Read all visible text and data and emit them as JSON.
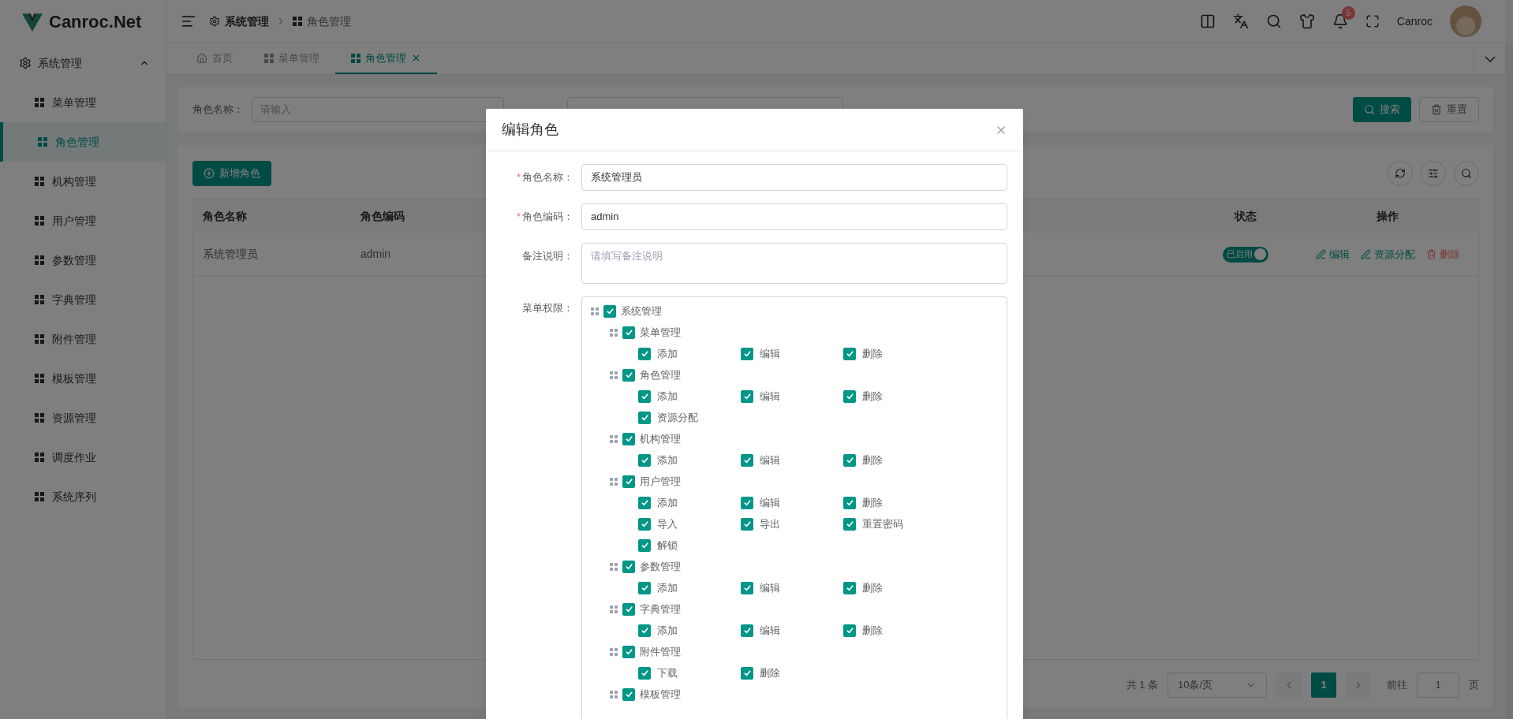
{
  "app": {
    "logo_text": "Canroc.Net"
  },
  "header": {
    "breadcrumb": [
      {
        "label": "系统管理"
      },
      {
        "label": "角色管理"
      }
    ],
    "notification_count": "5",
    "user_name": "Canroc"
  },
  "tabs": [
    {
      "label": "首页",
      "selected": false
    },
    {
      "label": "菜单管理",
      "selected": false
    },
    {
      "label": "角色管理",
      "selected": true
    }
  ],
  "sidebar": {
    "items": [
      {
        "label": "系统管理",
        "expanded": true,
        "children": [
          {
            "label": "菜单管理",
            "selected": false
          },
          {
            "label": "角色管理",
            "selected": true
          },
          {
            "label": "机构管理",
            "selected": false
          },
          {
            "label": "用户管理",
            "selected": false
          },
          {
            "label": "参数管理",
            "selected": false
          },
          {
            "label": "字典管理",
            "selected": false
          },
          {
            "label": "附件管理",
            "selected": false
          },
          {
            "label": "模板管理",
            "selected": false
          },
          {
            "label": "资源管理",
            "selected": false
          },
          {
            "label": "调度作业",
            "selected": false
          },
          {
            "label": "系统序列",
            "selected": false
          }
        ]
      }
    ]
  },
  "search": {
    "label": "角色名称：",
    "placeholder": "请输入",
    "buttons": [
      {
        "label": "搜索",
        "kind": "primary"
      },
      {
        "label": "重置",
        "kind": "default"
      }
    ]
  },
  "table": {
    "add_button": "新增角色",
    "columns": [
      "角色名称",
      "角色编码",
      "状态",
      "操作"
    ],
    "rows": [
      {
        "cells": [
          "系统管理员",
          "admin"
        ],
        "status": {
          "label": "已启用",
          "on": true
        },
        "actions": [
          {
            "label": "编辑",
            "kind": "edit"
          },
          {
            "label": "资源分配",
            "kind": "edit"
          },
          {
            "label": "删除",
            "kind": "delete"
          }
        ]
      }
    ]
  },
  "pagination": {
    "total": "共 1 条",
    "page_size": "10条/页",
    "pages": [
      {
        "label": "1",
        "selected": true
      }
    ],
    "goto_label": "前往",
    "goto_value": "1",
    "goto_suffix": "页"
  },
  "dialog": {
    "title": "编辑角色",
    "fields": [
      {
        "label": "角色名称：",
        "required_mark": "*",
        "kind": "input",
        "value": "系统管理员"
      },
      {
        "label": "角色编码：",
        "required_mark": "*",
        "kind": "input",
        "value": "admin"
      },
      {
        "label": "备注说明：",
        "kind": "textarea",
        "placeholder": "请填写备注说明"
      }
    ],
    "tree_label": "菜单权限：",
    "tree": [
      {
        "label": "系统管理",
        "checked": true,
        "children": [
          {
            "label": "菜单管理",
            "checked": true,
            "actions": [
              {
                "label": "添加",
                "checked": true
              },
              {
                "label": "编辑",
                "checked": true
              },
              {
                "label": "删除",
                "checked": true
              }
            ]
          },
          {
            "label": "角色管理",
            "checked": true,
            "actions": [
              {
                "label": "添加",
                "checked": true
              },
              {
                "label": "编辑",
                "checked": true
              },
              {
                "label": "删除",
                "checked": true
              },
              {
                "label": "资源分配",
                "checked": true
              }
            ]
          },
          {
            "label": "机构管理",
            "checked": true,
            "actions": [
              {
                "label": "添加",
                "checked": true
              },
              {
                "label": "编辑",
                "checked": true
              },
              {
                "label": "删除",
                "checked": true
              }
            ]
          },
          {
            "label": "用户管理",
            "checked": true,
            "actions": [
              {
                "label": "添加",
                "checked": true
              },
              {
                "label": "编辑",
                "checked": true
              },
              {
                "label": "删除",
                "checked": true
              },
              {
                "label": "导入",
                "checked": true
              },
              {
                "label": "导出",
                "checked": true
              },
              {
                "label": "重置密码",
                "checked": true
              },
              {
                "label": "解锁",
                "checked": true
              }
            ]
          },
          {
            "label": "参数管理",
            "checked": true,
            "actions": [
              {
                "label": "添加",
                "checked": true
              },
              {
                "label": "编辑",
                "checked": true
              },
              {
                "label": "删除",
                "checked": true
              }
            ]
          },
          {
            "label": "字典管理",
            "checked": true,
            "actions": [
              {
                "label": "添加",
                "checked": true
              },
              {
                "label": "编辑",
                "checked": true
              },
              {
                "label": "删除",
                "checked": true
              }
            ]
          },
          {
            "label": "附件管理",
            "checked": true,
            "actions": [
              {
                "label": "下载",
                "checked": true
              },
              {
                "label": "删除",
                "checked": true
              }
            ]
          },
          {
            "label": "模板管理",
            "checked": true
          }
        ]
      }
    ]
  }
}
